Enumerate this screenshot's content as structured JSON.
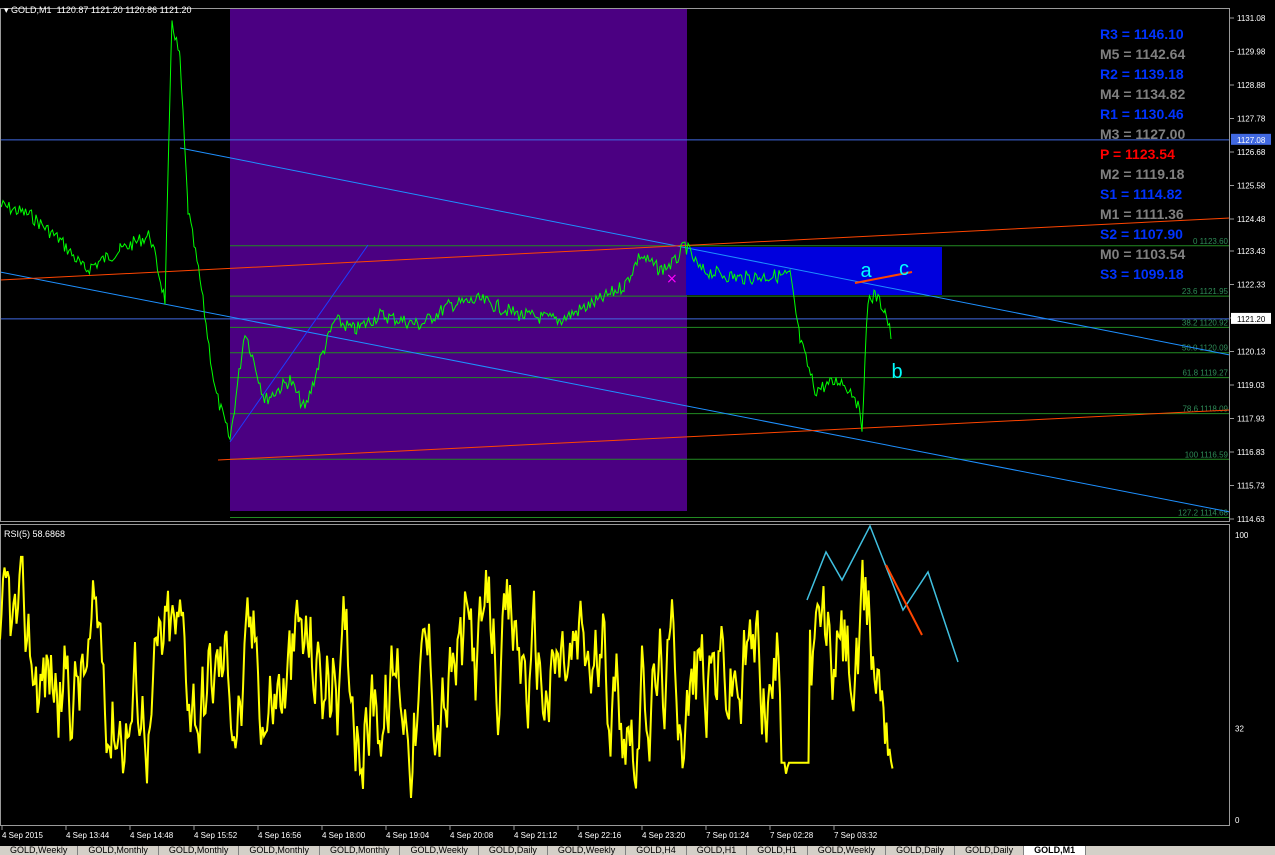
{
  "header": {
    "symbol": "GOLD,M1",
    "ohlc": "1120.87 1121.20 1120.86 1121.20"
  },
  "rsi": {
    "label": "RSI(5) 58.6868",
    "levels": [
      "100",
      "32",
      "0"
    ]
  },
  "price_axis": [
    "1131.08",
    "1129.98",
    "1128.88",
    "1127.78",
    "1126.68",
    "1125.58",
    "1124.48",
    "1123.43",
    "1122.33",
    "1121.23",
    "1120.13",
    "1119.03",
    "1117.93",
    "1116.83",
    "1115.73",
    "1114.63"
  ],
  "price_markers": {
    "line": "1127.08",
    "current": "1121.20"
  },
  "time_axis": [
    "4 Sep 2015",
    "4 Sep 13:44",
    "4 Sep 14:48",
    "4 Sep 15:52",
    "4 Sep 16:56",
    "4 Sep 18:00",
    "4 Sep 19:04",
    "4 Sep 20:08",
    "4 Sep 21:12",
    "4 Sep 22:16",
    "4 Sep 23:20",
    "7 Sep 01:24",
    "7 Sep 02:28",
    "7 Sep 03:32"
  ],
  "pivots": [
    {
      "label": "R3",
      "value": "1146.10",
      "color": "#0033ff"
    },
    {
      "label": "M5",
      "value": "1142.64",
      "color": "#808080"
    },
    {
      "label": "R2",
      "value": "1139.18",
      "color": "#0033ff"
    },
    {
      "label": "M4",
      "value": "1134.82",
      "color": "#808080"
    },
    {
      "label": "R1",
      "value": "1130.46",
      "color": "#0033ff"
    },
    {
      "label": "M3",
      "value": "1127.00",
      "color": "#808080"
    },
    {
      "label": "P ",
      "value": "1123.54",
      "color": "#ff0000"
    },
    {
      "label": "M2",
      "value": "1119.18",
      "color": "#808080"
    },
    {
      "label": "S1",
      "value": "1114.82",
      "color": "#0033ff"
    },
    {
      "label": "M1",
      "value": "1111.36",
      "color": "#808080"
    },
    {
      "label": "S2",
      "value": "1107.90",
      "color": "#0033ff"
    },
    {
      "label": "M0",
      "value": "1103.54",
      "color": "#808080"
    },
    {
      "label": "S3",
      "value": "1099.18",
      "color": "#0033ff"
    }
  ],
  "fib_levels": [
    {
      "label": "0 1123.60",
      "price": 1123.6
    },
    {
      "label": "23.6 1121.95",
      "price": 1121.95
    },
    {
      "label": "38.2 1120.92",
      "price": 1120.92
    },
    {
      "label": "50.0 1120.09",
      "price": 1120.09
    },
    {
      "label": "61.8 1119.27",
      "price": 1119.27
    },
    {
      "label": "78.6 1118.09",
      "price": 1118.09
    },
    {
      "label": "100 1116.59",
      "price": 1116.59
    },
    {
      "label": "127.2 1114.68",
      "price": 1114.68
    }
  ],
  "wave_labels": [
    "a",
    "b",
    "c"
  ],
  "tabs": [
    "GOLD,Weekly",
    "GOLD,Monthly",
    "GOLD,Monthly",
    "GOLD,Monthly",
    "GOLD,Monthly",
    "GOLD,Weekly",
    "GOLD,Daily",
    "GOLD,Weekly",
    "GOLD,H4",
    "GOLD,H1",
    "GOLD,H1",
    "GOLD,Weekly",
    "GOLD,Daily",
    "GOLD,Daily",
    "GOLD,M1"
  ],
  "active_tab": 14,
  "colors": {
    "background": "#000000",
    "price_line": "#00ff00",
    "rsi_line": "#ffff00",
    "session_box": "#4b0082",
    "zone_box": "#0000dd",
    "channel": "#1e90ff",
    "trendline": "#ff4500",
    "fib": "#228b22",
    "wave_label": "#00ffff"
  }
}
